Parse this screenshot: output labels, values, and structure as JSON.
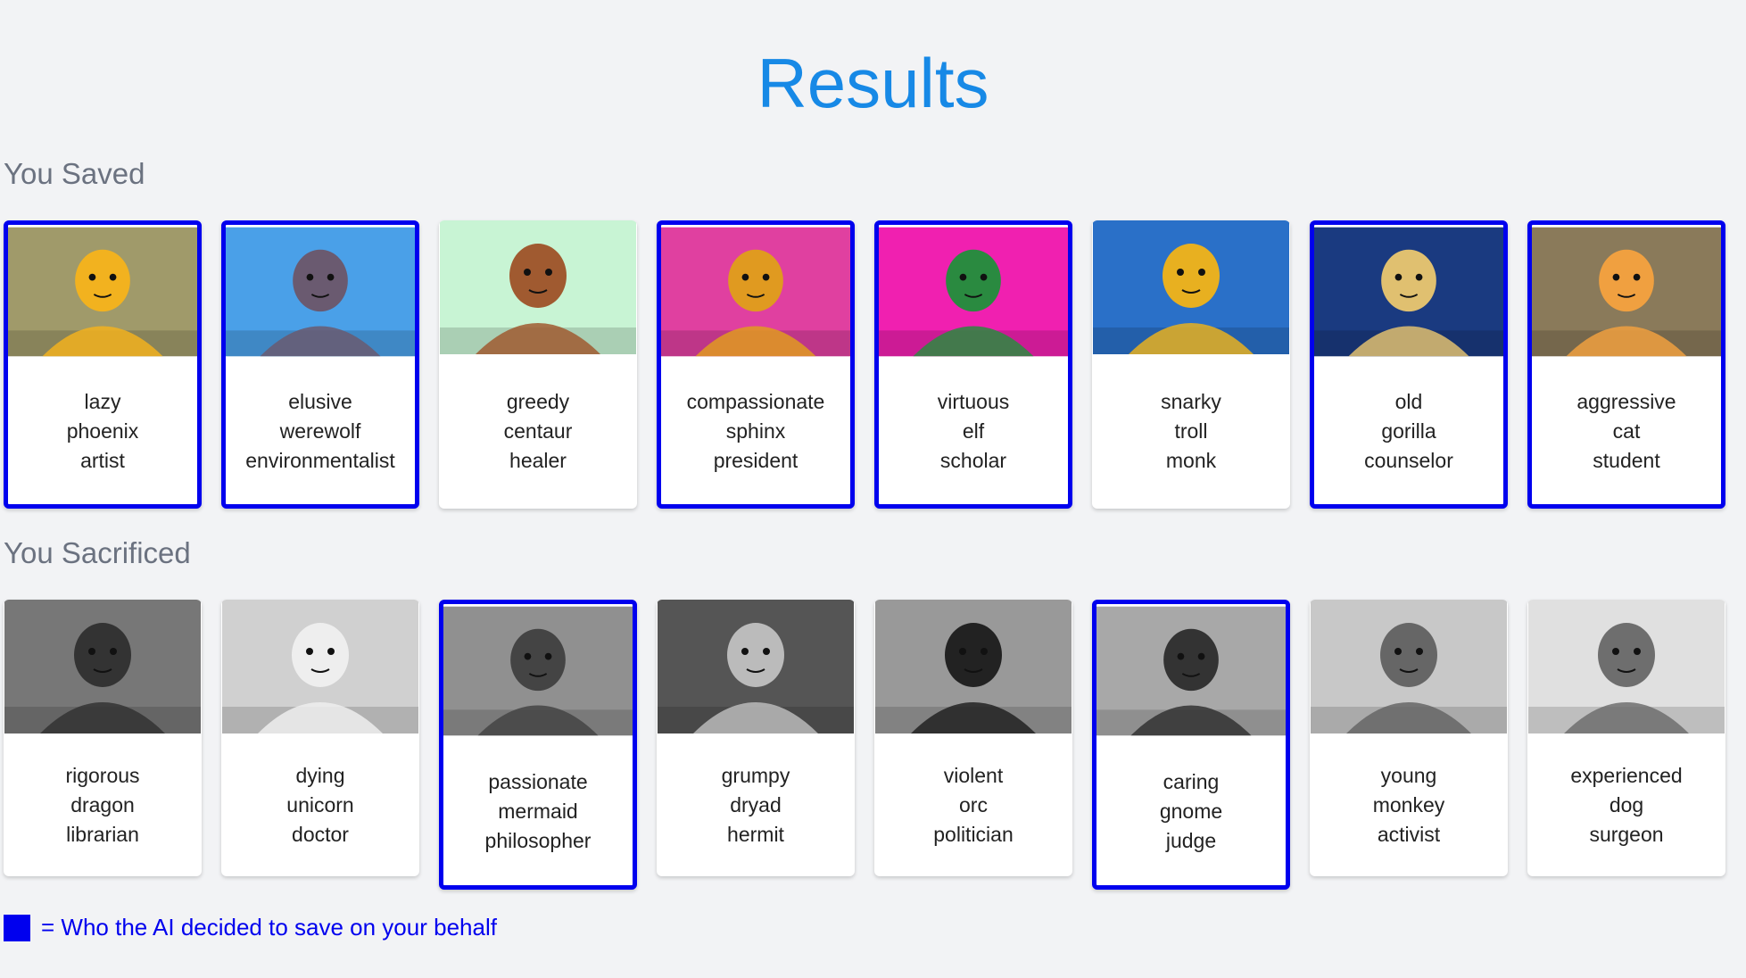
{
  "title": "Results",
  "saved": {
    "label": "You Saved",
    "cards": [
      {
        "words": [
          "lazy",
          "phoenix",
          "artist"
        ],
        "ai": true,
        "icon": "phoenix-portrait",
        "bg": "#a09a6a",
        "fg": "#f2b21f"
      },
      {
        "words": [
          "elusive",
          "werewolf",
          "environmentalist"
        ],
        "ai": true,
        "icon": "werewolf-portrait",
        "bg": "#4aa0e8",
        "fg": "#6a5a70"
      },
      {
        "words": [
          "greedy",
          "centaur",
          "healer"
        ],
        "ai": false,
        "icon": "centaur-portrait",
        "bg": "#c8f4d4",
        "fg": "#a05a30"
      },
      {
        "words": [
          "compassionate",
          "sphinx",
          "president"
        ],
        "ai": true,
        "icon": "sphinx-portrait",
        "bg": "#e040a0",
        "fg": "#e09a20"
      },
      {
        "words": [
          "virtuous",
          "elf",
          "scholar"
        ],
        "ai": true,
        "icon": "elf-portrait",
        "bg": "#f020b0",
        "fg": "#2a8a40"
      },
      {
        "words": [
          "snarky",
          "troll",
          "monk"
        ],
        "ai": false,
        "icon": "troll-portrait",
        "bg": "#2a70c8",
        "fg": "#e8b020"
      },
      {
        "words": [
          "old",
          "gorilla",
          "counselor"
        ],
        "ai": true,
        "icon": "gorilla-portrait",
        "bg": "#1a3a80",
        "fg": "#e0c070"
      },
      {
        "words": [
          "aggressive",
          "cat",
          "student"
        ],
        "ai": true,
        "icon": "cat-portrait",
        "bg": "#8a7a5a",
        "fg": "#f0a040"
      }
    ]
  },
  "sacrificed": {
    "label": "You Sacrificed",
    "cards": [
      {
        "words": [
          "rigorous",
          "dragon",
          "librarian"
        ],
        "ai": false,
        "icon": "dragon-portrait",
        "bg": "#777777",
        "fg": "#333333"
      },
      {
        "words": [
          "dying",
          "unicorn",
          "doctor"
        ],
        "ai": false,
        "icon": "unicorn-portrait",
        "bg": "#d0d0d0",
        "fg": "#eeeeee"
      },
      {
        "words": [
          "passionate",
          "mermaid",
          "philosopher"
        ],
        "ai": true,
        "icon": "mermaid-portrait",
        "bg": "#909090",
        "fg": "#444444"
      },
      {
        "words": [
          "grumpy",
          "dryad",
          "hermit"
        ],
        "ai": false,
        "icon": "dryad-portrait",
        "bg": "#555555",
        "fg": "#bbbbbb"
      },
      {
        "words": [
          "violent",
          "orc",
          "politician"
        ],
        "ai": false,
        "icon": "orc-portrait",
        "bg": "#999999",
        "fg": "#222222"
      },
      {
        "words": [
          "caring",
          "gnome",
          "judge"
        ],
        "ai": true,
        "icon": "gnome-portrait",
        "bg": "#a8a8a8",
        "fg": "#333333"
      },
      {
        "words": [
          "young",
          "monkey",
          "activist"
        ],
        "ai": false,
        "icon": "monkey-portrait",
        "bg": "#c8c8c8",
        "fg": "#666666"
      },
      {
        "words": [
          "experienced",
          "dog",
          "surgeon"
        ],
        "ai": false,
        "icon": "dog-portrait",
        "bg": "#e0e0e0",
        "fg": "#8a6a4a"
      }
    ]
  },
  "legend": {
    "text": "= Who the AI decided to save on your behalf",
    "color": "#0000ee"
  }
}
